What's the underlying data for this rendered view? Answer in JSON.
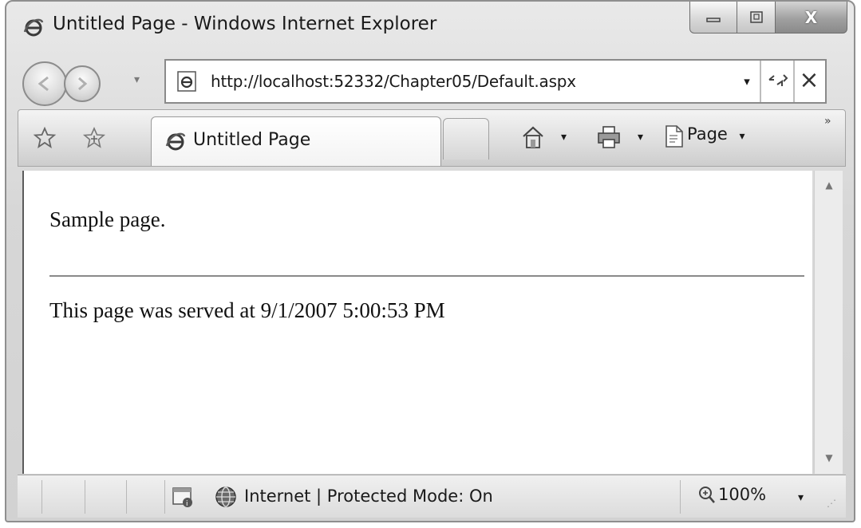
{
  "window": {
    "title": "Untitled Page - Windows Internet Explorer",
    "icon": "ie-icon",
    "caption_buttons": [
      "minimize-icon",
      "maximize-icon",
      "close-icon"
    ],
    "caption_close_label": "X"
  },
  "address_bar": {
    "url": "http://localhost:52332/Chapter05/Default.aspx",
    "page_icon": "ie-page-icon",
    "dropdown_glyph": "▾",
    "refresh_glyph": "⁴⁄",
    "stop_glyph": "×"
  },
  "navigation": {
    "back_icon": "back-arrow-icon",
    "forward_icon": "forward-arrow-icon",
    "history_dropdown_glyph": "▾"
  },
  "tabbar": {
    "favorites_icon": "star-icon",
    "add_favorites_icon": "add-star-icon",
    "active_tab_label": "Untitled Page",
    "home_icon": "home-icon",
    "print_icon": "printer-icon",
    "page_menu_label": "Page",
    "dropdown_glyph": "▾",
    "overflow_glyph": "»"
  },
  "content": {
    "sample_text": "Sample page.",
    "served_text": "This page was served at 9/1/2007 5:00:53 PM"
  },
  "scrollbar": {
    "up_glyph": "▲",
    "down_glyph": "▼"
  },
  "statusbar": {
    "zone_text": "Internet | Protected Mode: On",
    "zoom_text": "100%",
    "zoom_dropdown_glyph": "▾",
    "resize_grip_glyph": "⋰"
  }
}
